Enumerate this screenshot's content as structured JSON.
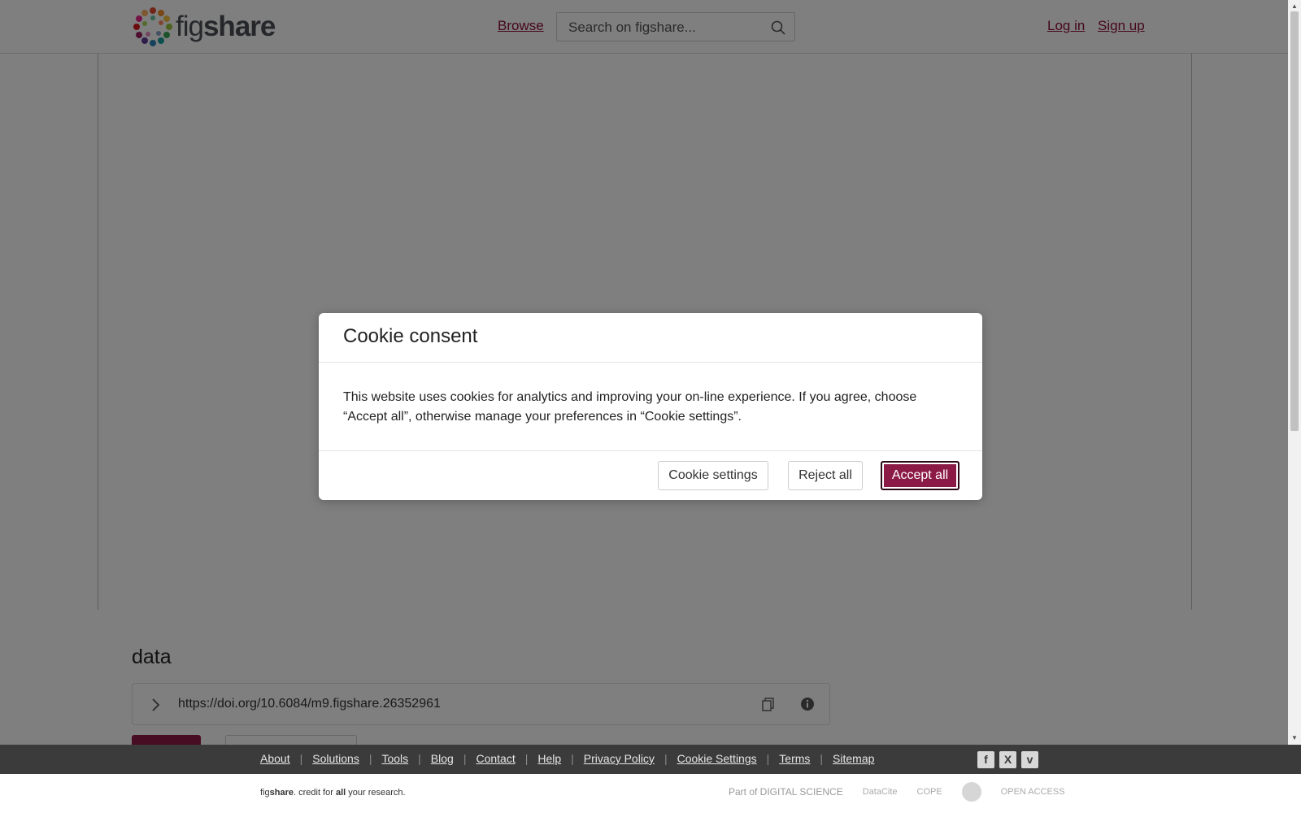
{
  "header": {
    "logo_prefix": "fig",
    "logo_bold": "share",
    "browse_label": "Browse",
    "search_placeholder": "Search on figshare...",
    "login_label": "Log in",
    "signup_label": "Sign up"
  },
  "item": {
    "title": "data",
    "doi": "https://doi.org/10.6084/m9.figshare.26352961"
  },
  "cookie_modal": {
    "title": "Cookie consent",
    "body": "This website uses cookies for analytics and improving your on-line experience. If you agree, choose “Accept all”, otherwise manage your preferences in “Cookie settings”.",
    "settings_label": "Cookie settings",
    "reject_label": "Reject all",
    "accept_label": "Accept all"
  },
  "footer": {
    "links": [
      "About",
      "Solutions",
      "Tools",
      "Blog",
      "Contact",
      "Help",
      "Privacy Policy",
      "Cookie Settings",
      "Terms",
      "Sitemap"
    ],
    "tagline_fig": "fig",
    "tagline_share": "share",
    "tagline_mid": ". credit for ",
    "tagline_all": "all",
    "tagline_end": " your research.",
    "social_icons": [
      "facebook-icon",
      "x-icon",
      "vimeo-icon"
    ],
    "partner_digital_science": "Part of DIGITAL SCIENCE",
    "partner_datacite": "DataCite",
    "partner_cope": "COPE",
    "partner_open_access": "OPEN ACCESS"
  },
  "colors": {
    "brand": "#8c1a47",
    "link": "#8c0e3a",
    "footer_bg": "#3b3b3b"
  }
}
